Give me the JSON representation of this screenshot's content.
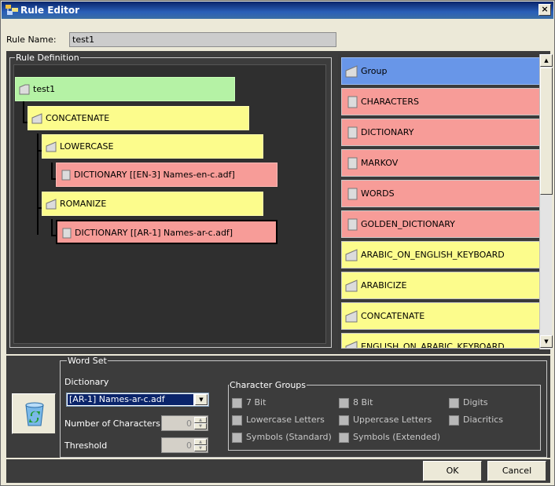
{
  "window": {
    "title": "Rule Editor",
    "close_label": "×"
  },
  "rule_name": {
    "label": "Rule Name:",
    "value": "test1"
  },
  "definition": {
    "legend": "Rule Definition",
    "nodes": [
      {
        "label": "test1",
        "color": "#b5f2a5"
      },
      {
        "label": "CONCATENATE",
        "color": "#fcfc8c"
      },
      {
        "label": "LOWERCASE",
        "color": "#fcfc8c"
      },
      {
        "label": "DICTIONARY [[EN-3] Names-en-c.adf]",
        "color": "#f79c98"
      },
      {
        "label": "ROMANIZE",
        "color": "#fcfc8c"
      },
      {
        "label": "DICTIONARY [[AR-1] Names-ar-c.adf]",
        "color": "#f79c98",
        "selected": true
      }
    ]
  },
  "palette": {
    "items": [
      {
        "label": "Group",
        "color": "#6896e8"
      },
      {
        "label": "CHARACTERS",
        "color": "#f79c98"
      },
      {
        "label": "DICTIONARY",
        "color": "#f79c98"
      },
      {
        "label": "MARKOV",
        "color": "#f79c98"
      },
      {
        "label": "WORDS",
        "color": "#f79c98"
      },
      {
        "label": "GOLDEN_DICTIONARY",
        "color": "#f79c98"
      },
      {
        "label": "ARABIC_ON_ENGLISH_KEYBOARD",
        "color": "#fcfc8c"
      },
      {
        "label": "ARABICIZE",
        "color": "#fcfc8c"
      },
      {
        "label": "CONCATENATE",
        "color": "#fcfc8c"
      },
      {
        "label": "ENGLISH_ON_ARABIC_KEYBOARD",
        "color": "#fcfc8c"
      }
    ]
  },
  "word_set": {
    "legend": "Word Set",
    "dictionary_label": "Dictionary",
    "dictionary_value": "[AR-1] Names-ar-c.adf",
    "num_chars_label": "Number of Characters",
    "num_chars_value": "0",
    "threshold_label": "Threshold",
    "threshold_value": "0",
    "character_groups": {
      "legend": "Character Groups",
      "options": {
        "bit7": "7 Bit",
        "bit8": "8 Bit",
        "digits": "Digits",
        "lowercase": "Lowercase Letters",
        "uppercase": "Uppercase Letters",
        "diacritics": "Diacritics",
        "symbols_standard": "Symbols (Standard)",
        "symbols_extended": "Symbols (Extended)"
      }
    }
  },
  "buttons": {
    "ok": "OK",
    "cancel": "Cancel"
  }
}
